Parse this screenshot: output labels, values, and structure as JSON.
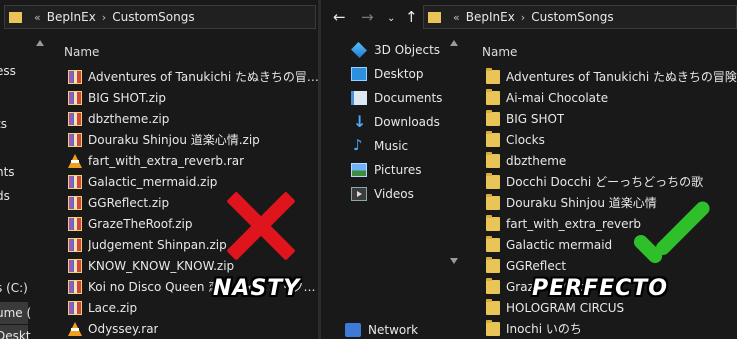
{
  "left": {
    "breadcrumb": [
      "BepInEx",
      "CustomSongs"
    ],
    "column_header": "Name",
    "nav_fragments": [
      {
        "label": "ess",
        "selected": false
      },
      {
        "label": "ts",
        "selected": false
      },
      {
        "label": "nts",
        "selected": false
      },
      {
        "label": "ds",
        "selected": false
      },
      {
        "label": "s (C:)",
        "selected": false
      },
      {
        "label": "ume (",
        "selected": true
      },
      {
        "label": "Deskt",
        "selected": false
      }
    ],
    "files": [
      {
        "name": "Adventures of Tanukichi たぬきちの冒険....",
        "type": "zip"
      },
      {
        "name": "BIG SHOT.zip",
        "type": "zip"
      },
      {
        "name": "dbztheme.zip",
        "type": "zip"
      },
      {
        "name": "Douraku Shinjou 道楽心情.zip",
        "type": "zip"
      },
      {
        "name": "fart_with_extra_reverb.rar",
        "type": "rar"
      },
      {
        "name": "Galactic_mermaid.zip",
        "type": "zip"
      },
      {
        "name": "GGReflect.zip",
        "type": "zip"
      },
      {
        "name": "GrazeTheRoof.zip",
        "type": "zip"
      },
      {
        "name": "Judgement Shinpan.zip",
        "type": "zip"
      },
      {
        "name": "KNOW_KNOW_KNOW.zip",
        "type": "zip"
      },
      {
        "name": "Koi no Disco Queen 恋のディスコ・クイーン.zip",
        "type": "zip"
      },
      {
        "name": "Lace.zip",
        "type": "zip"
      },
      {
        "name": "Odyssey.rar",
        "type": "rar"
      }
    ]
  },
  "right": {
    "breadcrumb": [
      "BepInEx",
      "CustomSongs"
    ],
    "column_header": "Name",
    "nav": {
      "back_icon": "arrow-left-icon",
      "forward_icon": "arrow-right-icon",
      "recent_icon": "chevron-down-icon",
      "up_icon": "arrow-up-icon"
    },
    "quick_access": [
      {
        "label": "3D Objects",
        "icon": "3d"
      },
      {
        "label": "Desktop",
        "icon": "desktop"
      },
      {
        "label": "Documents",
        "icon": "documents"
      },
      {
        "label": "Downloads",
        "icon": "downloads"
      },
      {
        "label": "Music",
        "icon": "music"
      },
      {
        "label": "Pictures",
        "icon": "pictures"
      },
      {
        "label": "Videos",
        "icon": "videos"
      }
    ],
    "network_label": "Network",
    "folders": [
      "Adventures of Tanukichi たぬきちの冒険",
      "Ai-mai Chocolate",
      "BIG SHOT",
      "Clocks",
      "dbztheme",
      "Docchi Docchi どーっちどっちの歌",
      "Douraku Shinjou 道楽心情",
      "fart_with_extra_reverb",
      "Galactic mermaid",
      "GGReflect",
      "GrazeTheRoof",
      "HOLOGRAM CIRCUS",
      "Inochi いのち"
    ]
  },
  "overlay": {
    "bad_label": "NASTY",
    "good_label": "PERFECTO",
    "bad_color": "#e0141c",
    "good_color": "#2fbf2a"
  }
}
